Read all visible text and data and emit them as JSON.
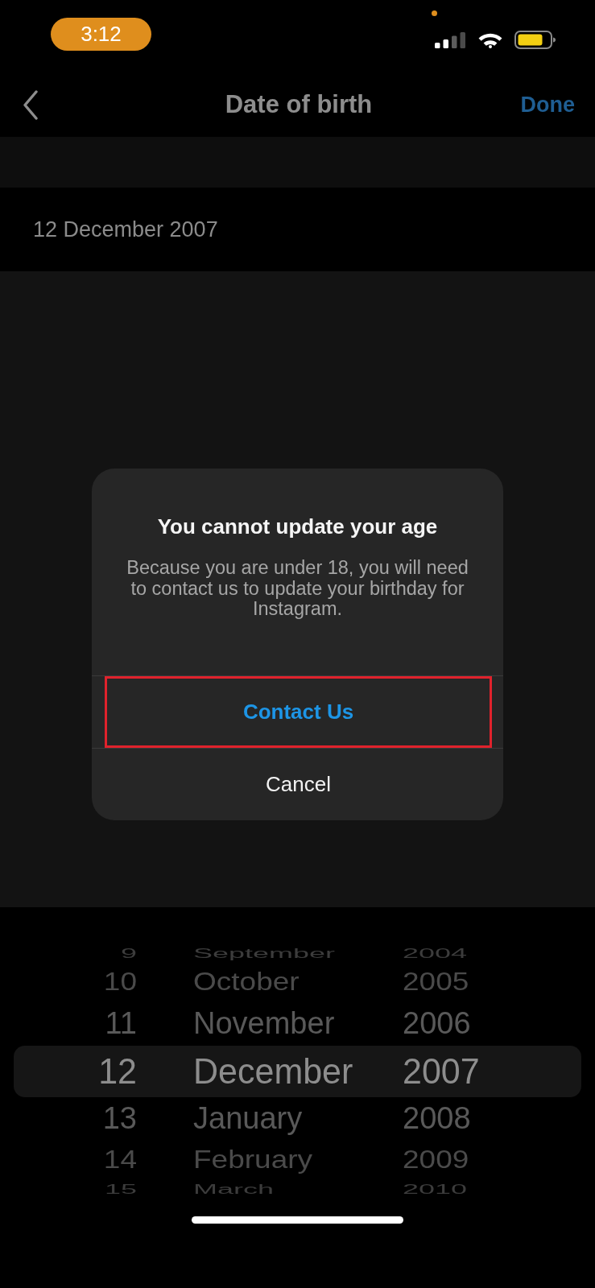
{
  "status_bar": {
    "time": "3:12"
  },
  "nav_bar": {
    "title": "Date of birth",
    "action": "Done"
  },
  "date_field": {
    "value": "12 December 2007"
  },
  "dialog": {
    "title": "You cannot update your age",
    "message": "Because you are under 18, you will need to contact us to update your birthday for Instagram.",
    "actions": [
      {
        "label": "Contact Us",
        "kind": "primary",
        "highlighted": true
      },
      {
        "label": "Cancel",
        "kind": "cancel",
        "highlighted": false
      }
    ]
  },
  "date_picker": {
    "columns": [
      {
        "kind": "day",
        "items": [
          {
            "label": "9",
            "selected": false
          },
          {
            "label": "10",
            "selected": false
          },
          {
            "label": "11",
            "selected": false
          },
          {
            "label": "12",
            "selected": true
          },
          {
            "label": "13",
            "selected": false
          },
          {
            "label": "14",
            "selected": false
          },
          {
            "label": "15",
            "selected": false
          }
        ]
      },
      {
        "kind": "month",
        "items": [
          {
            "label": "September",
            "selected": false
          },
          {
            "label": "October",
            "selected": false
          },
          {
            "label": "November",
            "selected": false
          },
          {
            "label": "December",
            "selected": true
          },
          {
            "label": "January",
            "selected": false
          },
          {
            "label": "February",
            "selected": false
          },
          {
            "label": "March",
            "selected": false
          }
        ]
      },
      {
        "kind": "year",
        "items": [
          {
            "label": "2004",
            "selected": false
          },
          {
            "label": "2005",
            "selected": false
          },
          {
            "label": "2006",
            "selected": false
          },
          {
            "label": "2007",
            "selected": true
          },
          {
            "label": "2008",
            "selected": false
          },
          {
            "label": "2009",
            "selected": false
          },
          {
            "label": "2010",
            "selected": false
          }
        ]
      }
    ]
  }
}
